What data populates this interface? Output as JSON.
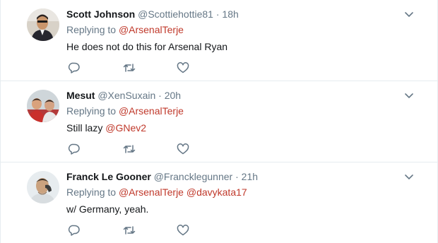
{
  "tweets": [
    {
      "name": "Scott Johnson",
      "handle": "@Scottiehottie81",
      "separator": "·",
      "time": "18h",
      "replying_prefix": "Replying to",
      "replying_to": [
        "@ArsenalTerje"
      ],
      "text_parts": [
        "He does not do this for Arsenal Ryan"
      ]
    },
    {
      "name": "Mesut",
      "handle": "@XenSuxain",
      "separator": "·",
      "time": "20h",
      "replying_prefix": "Replying to",
      "replying_to": [
        "@ArsenalTerje"
      ],
      "text_parts": [
        "Still lazy ",
        "@GNev2"
      ]
    },
    {
      "name": "Franck Le Gooner",
      "handle": "@Francklegunner",
      "separator": "·",
      "time": "21h",
      "replying_prefix": "Replying to",
      "replying_to": [
        "@ArsenalTerje",
        "@davykata17"
      ],
      "text_parts": [
        "w/ Germany, yeah."
      ]
    }
  ],
  "icons": {
    "reply": "reply-icon",
    "retweet": "retweet-icon",
    "like": "heart-icon",
    "menu": "chevron-down-icon"
  },
  "colors": {
    "accent": "#c0392b",
    "secondary_text": "#657786",
    "primary_text": "#14171a",
    "divider": "#e6ecf0"
  }
}
